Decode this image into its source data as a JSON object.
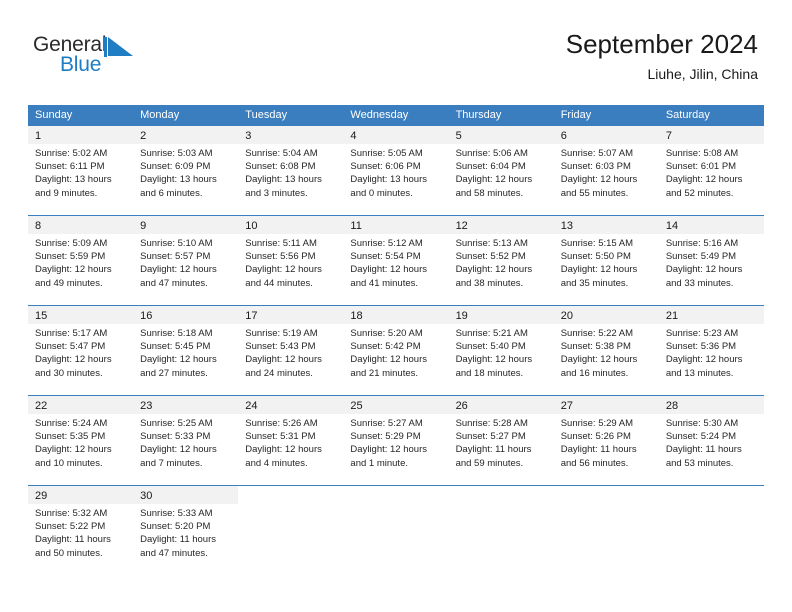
{
  "brand": {
    "name_part1": "General",
    "name_part2": "Blue",
    "logo_icon": "blue-triangle-flag-icon",
    "accent_color": "#1f7dc4"
  },
  "header": {
    "title": "September 2024",
    "location": "Liuhe, Jilin, China"
  },
  "theme": {
    "header_blue": "#3a7ebf",
    "daynum_band": "#f2f2f2",
    "text": "#262626"
  },
  "calendar": {
    "weekdays": [
      "Sunday",
      "Monday",
      "Tuesday",
      "Wednesday",
      "Thursday",
      "Friday",
      "Saturday"
    ],
    "weeks": [
      [
        {
          "day": "1",
          "sunrise": "Sunrise: 5:02 AM",
          "sunset": "Sunset: 6:11 PM",
          "daylight1": "Daylight: 13 hours",
          "daylight2": "and 9 minutes."
        },
        {
          "day": "2",
          "sunrise": "Sunrise: 5:03 AM",
          "sunset": "Sunset: 6:09 PM",
          "daylight1": "Daylight: 13 hours",
          "daylight2": "and 6 minutes."
        },
        {
          "day": "3",
          "sunrise": "Sunrise: 5:04 AM",
          "sunset": "Sunset: 6:08 PM",
          "daylight1": "Daylight: 13 hours",
          "daylight2": "and 3 minutes."
        },
        {
          "day": "4",
          "sunrise": "Sunrise: 5:05 AM",
          "sunset": "Sunset: 6:06 PM",
          "daylight1": "Daylight: 13 hours",
          "daylight2": "and 0 minutes."
        },
        {
          "day": "5",
          "sunrise": "Sunrise: 5:06 AM",
          "sunset": "Sunset: 6:04 PM",
          "daylight1": "Daylight: 12 hours",
          "daylight2": "and 58 minutes."
        },
        {
          "day": "6",
          "sunrise": "Sunrise: 5:07 AM",
          "sunset": "Sunset: 6:03 PM",
          "daylight1": "Daylight: 12 hours",
          "daylight2": "and 55 minutes."
        },
        {
          "day": "7",
          "sunrise": "Sunrise: 5:08 AM",
          "sunset": "Sunset: 6:01 PM",
          "daylight1": "Daylight: 12 hours",
          "daylight2": "and 52 minutes."
        }
      ],
      [
        {
          "day": "8",
          "sunrise": "Sunrise: 5:09 AM",
          "sunset": "Sunset: 5:59 PM",
          "daylight1": "Daylight: 12 hours",
          "daylight2": "and 49 minutes."
        },
        {
          "day": "9",
          "sunrise": "Sunrise: 5:10 AM",
          "sunset": "Sunset: 5:57 PM",
          "daylight1": "Daylight: 12 hours",
          "daylight2": "and 47 minutes."
        },
        {
          "day": "10",
          "sunrise": "Sunrise: 5:11 AM",
          "sunset": "Sunset: 5:56 PM",
          "daylight1": "Daylight: 12 hours",
          "daylight2": "and 44 minutes."
        },
        {
          "day": "11",
          "sunrise": "Sunrise: 5:12 AM",
          "sunset": "Sunset: 5:54 PM",
          "daylight1": "Daylight: 12 hours",
          "daylight2": "and 41 minutes."
        },
        {
          "day": "12",
          "sunrise": "Sunrise: 5:13 AM",
          "sunset": "Sunset: 5:52 PM",
          "daylight1": "Daylight: 12 hours",
          "daylight2": "and 38 minutes."
        },
        {
          "day": "13",
          "sunrise": "Sunrise: 5:15 AM",
          "sunset": "Sunset: 5:50 PM",
          "daylight1": "Daylight: 12 hours",
          "daylight2": "and 35 minutes."
        },
        {
          "day": "14",
          "sunrise": "Sunrise: 5:16 AM",
          "sunset": "Sunset: 5:49 PM",
          "daylight1": "Daylight: 12 hours",
          "daylight2": "and 33 minutes."
        }
      ],
      [
        {
          "day": "15",
          "sunrise": "Sunrise: 5:17 AM",
          "sunset": "Sunset: 5:47 PM",
          "daylight1": "Daylight: 12 hours",
          "daylight2": "and 30 minutes."
        },
        {
          "day": "16",
          "sunrise": "Sunrise: 5:18 AM",
          "sunset": "Sunset: 5:45 PM",
          "daylight1": "Daylight: 12 hours",
          "daylight2": "and 27 minutes."
        },
        {
          "day": "17",
          "sunrise": "Sunrise: 5:19 AM",
          "sunset": "Sunset: 5:43 PM",
          "daylight1": "Daylight: 12 hours",
          "daylight2": "and 24 minutes."
        },
        {
          "day": "18",
          "sunrise": "Sunrise: 5:20 AM",
          "sunset": "Sunset: 5:42 PM",
          "daylight1": "Daylight: 12 hours",
          "daylight2": "and 21 minutes."
        },
        {
          "day": "19",
          "sunrise": "Sunrise: 5:21 AM",
          "sunset": "Sunset: 5:40 PM",
          "daylight1": "Daylight: 12 hours",
          "daylight2": "and 18 minutes."
        },
        {
          "day": "20",
          "sunrise": "Sunrise: 5:22 AM",
          "sunset": "Sunset: 5:38 PM",
          "daylight1": "Daylight: 12 hours",
          "daylight2": "and 16 minutes."
        },
        {
          "day": "21",
          "sunrise": "Sunrise: 5:23 AM",
          "sunset": "Sunset: 5:36 PM",
          "daylight1": "Daylight: 12 hours",
          "daylight2": "and 13 minutes."
        }
      ],
      [
        {
          "day": "22",
          "sunrise": "Sunrise: 5:24 AM",
          "sunset": "Sunset: 5:35 PM",
          "daylight1": "Daylight: 12 hours",
          "daylight2": "and 10 minutes."
        },
        {
          "day": "23",
          "sunrise": "Sunrise: 5:25 AM",
          "sunset": "Sunset: 5:33 PM",
          "daylight1": "Daylight: 12 hours",
          "daylight2": "and 7 minutes."
        },
        {
          "day": "24",
          "sunrise": "Sunrise: 5:26 AM",
          "sunset": "Sunset: 5:31 PM",
          "daylight1": "Daylight: 12 hours",
          "daylight2": "and 4 minutes."
        },
        {
          "day": "25",
          "sunrise": "Sunrise: 5:27 AM",
          "sunset": "Sunset: 5:29 PM",
          "daylight1": "Daylight: 12 hours",
          "daylight2": "and 1 minute."
        },
        {
          "day": "26",
          "sunrise": "Sunrise: 5:28 AM",
          "sunset": "Sunset: 5:27 PM",
          "daylight1": "Daylight: 11 hours",
          "daylight2": "and 59 minutes."
        },
        {
          "day": "27",
          "sunrise": "Sunrise: 5:29 AM",
          "sunset": "Sunset: 5:26 PM",
          "daylight1": "Daylight: 11 hours",
          "daylight2": "and 56 minutes."
        },
        {
          "day": "28",
          "sunrise": "Sunrise: 5:30 AM",
          "sunset": "Sunset: 5:24 PM",
          "daylight1": "Daylight: 11 hours",
          "daylight2": "and 53 minutes."
        }
      ],
      [
        {
          "day": "29",
          "sunrise": "Sunrise: 5:32 AM",
          "sunset": "Sunset: 5:22 PM",
          "daylight1": "Daylight: 11 hours",
          "daylight2": "and 50 minutes."
        },
        {
          "day": "30",
          "sunrise": "Sunrise: 5:33 AM",
          "sunset": "Sunset: 5:20 PM",
          "daylight1": "Daylight: 11 hours",
          "daylight2": "and 47 minutes."
        },
        {
          "day": "",
          "sunrise": "",
          "sunset": "",
          "daylight1": "",
          "daylight2": ""
        },
        {
          "day": "",
          "sunrise": "",
          "sunset": "",
          "daylight1": "",
          "daylight2": ""
        },
        {
          "day": "",
          "sunrise": "",
          "sunset": "",
          "daylight1": "",
          "daylight2": ""
        },
        {
          "day": "",
          "sunrise": "",
          "sunset": "",
          "daylight1": "",
          "daylight2": ""
        },
        {
          "day": "",
          "sunrise": "",
          "sunset": "",
          "daylight1": "",
          "daylight2": ""
        }
      ]
    ]
  }
}
